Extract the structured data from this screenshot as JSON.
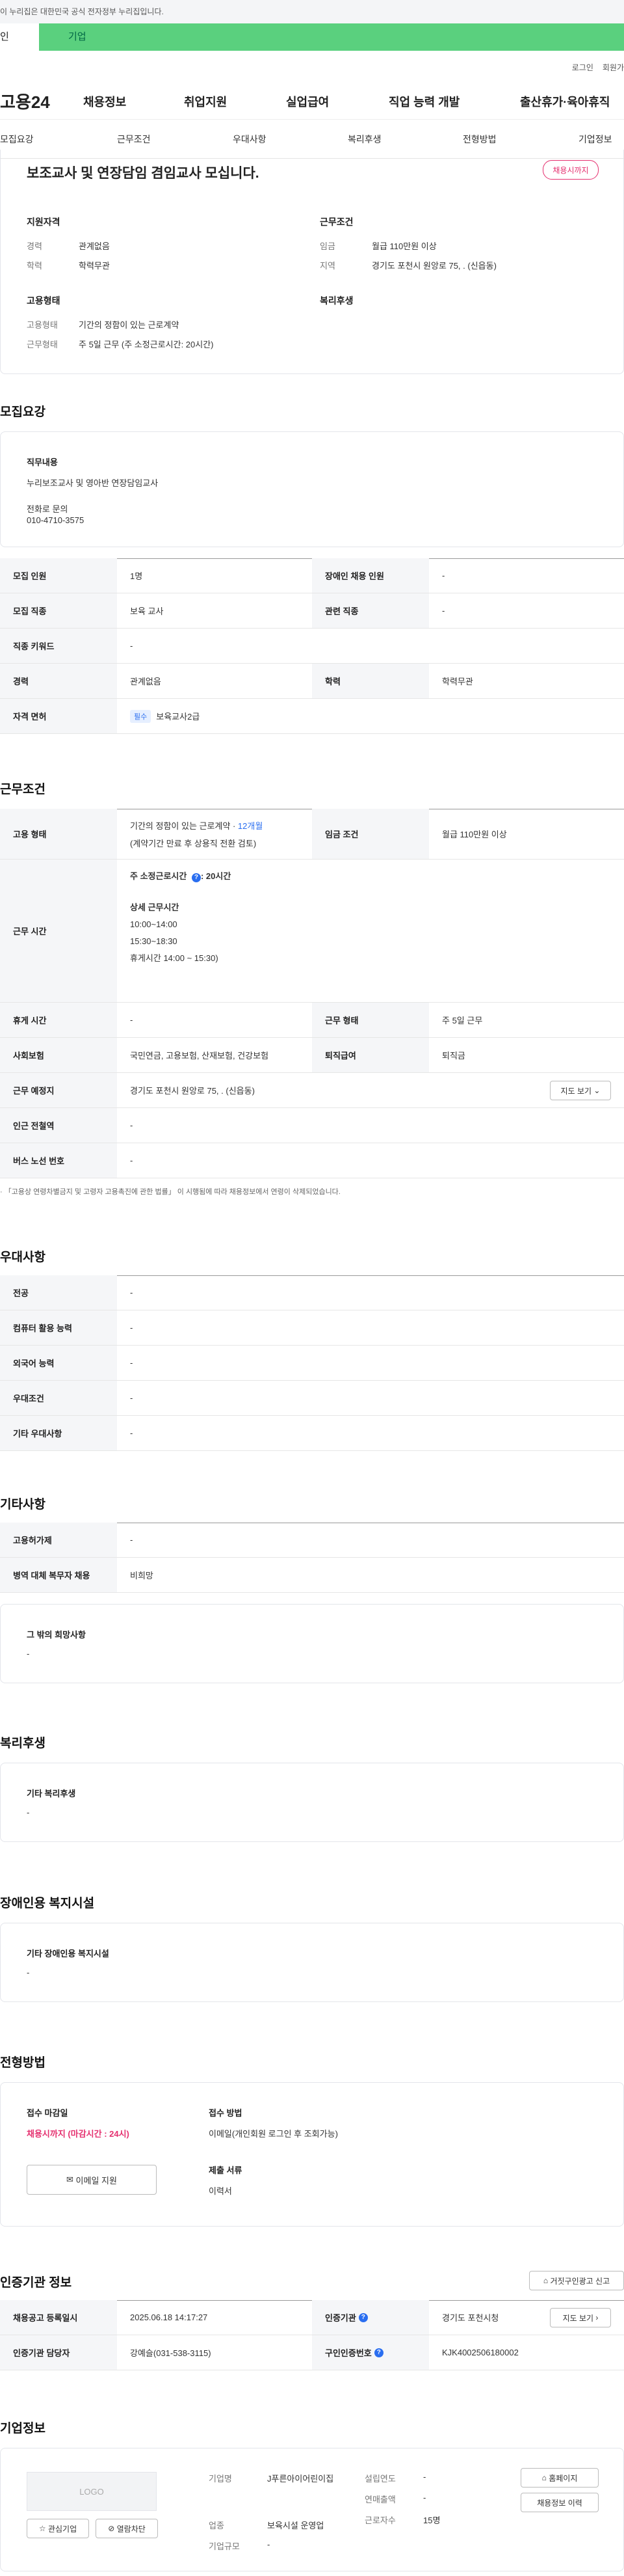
{
  "notice": "이 누리집은 대한민국 공식 전자정부 누리집입니다.",
  "tabs": {
    "person": "인",
    "biz": "기업"
  },
  "util": {
    "login": "로그인",
    "join": "회원가"
  },
  "gnb": {
    "logo": "고용24",
    "items": [
      "채용정보",
      "취업지원",
      "실업급여",
      "직업 능력 개발",
      "출산휴가·육아휴직"
    ]
  },
  "subnav": [
    "모집요강",
    "근무조건",
    "우대사항",
    "복리후생",
    "전형방법",
    "기업정보"
  ],
  "summary": {
    "title": "보조교사 및 연장담임 겸임교사 모십니다.",
    "status": "채용시까지",
    "qual_h": "지원자격",
    "career_l": "경력",
    "career_v": "관계없음",
    "edu_l": "학력",
    "edu_v": "학력무관",
    "cond_h": "근무조건",
    "wage_l": "임금",
    "wage_v": "월급 110만원 이상",
    "loc_l": "지역",
    "loc_v": "경기도 포천시 원앙로 75, . (신읍동)",
    "emp_h": "고용형태",
    "emptype_l": "고용형태",
    "emptype_v": "기간의 정함이 있는 근로계약",
    "worktype_l": "근무형태",
    "worktype_v": "주 5일 근무 (주 소정근로시간: 20시간)",
    "welfare_h": "복리후생"
  },
  "recruit": {
    "h": "모집요강",
    "job_h": "직무내용",
    "job_v": "누리보조교사 및 영아반 연장담임교사",
    "contact1": "전화로 문의",
    "contact2": "010-4710-3575",
    "rows": [
      [
        "모집 인원",
        "1명",
        "장애인 채용 인원",
        "-"
      ],
      [
        "모집 직종",
        "보육 교사",
        "관련 직종",
        "-"
      ],
      [
        "직종 키워드",
        "-"
      ],
      [
        "경력",
        "관계없음",
        "학력",
        "학력무관"
      ],
      [
        "자격 면허",
        "필수",
        "보육교사2급"
      ]
    ]
  },
  "work": {
    "h": "근무조건",
    "emp_l": "고용 형태",
    "emp_v1": "기간의 정함이 있는 근로계약 · ",
    "emp_v1b": "12개월",
    "emp_v2": "(계약기간 만료 후 상용직 전환 검토)",
    "wage_l": "임금 조건",
    "wage_v": "월급 110만원 이상",
    "time_l": "근무 시간",
    "time_main": "주 소정근로시간 ",
    "time_hours": ": 20시간",
    "detail_h": "상세 근무시간",
    "t1": "10:00~14:00",
    "t2": "15:30~18:30",
    "t3": "휴게시간 14:00 ~ 15:30)",
    "rows": [
      [
        "휴게 시간",
        "-",
        "근무 형태",
        "주 5일 근무"
      ],
      [
        "사회보험",
        "국민연금, 고용보험, 산재보험, 건강보험",
        "퇴직급여",
        "퇴직금"
      ],
      [
        "근무 예정지",
        "경기도 포천시 원앙로 75, . (신읍동)",
        "지도 보기"
      ],
      [
        "인근 전철역",
        "-"
      ],
      [
        "버스 노선 번호",
        "-"
      ]
    ],
    "footnote": "「고용상 연령차별금지 및 고령자 고용촉진에 관한 법률」 이 시행됨에 따라 채용정보에서 연령이 삭제되었습니다."
  },
  "pref": {
    "h": "우대사항",
    "rows": [
      [
        "전공",
        "-"
      ],
      [
        "컴퓨터 활용 능력",
        "-"
      ],
      [
        "외국어 능력",
        "-"
      ],
      [
        "우대조건",
        "-"
      ],
      [
        "기타 우대사항",
        "-"
      ]
    ]
  },
  "other": {
    "h": "기타사항",
    "rows": [
      [
        "고용허가제",
        "-"
      ],
      [
        "병역 대체 복무자 채용",
        "비희망"
      ]
    ],
    "box_h": "그 밖의 희망사항",
    "box_v": "-"
  },
  "welfare": {
    "h": "복리후생",
    "box_h": "기타 복리후생",
    "box_v": "-"
  },
  "disabled": {
    "h": "장애인용 복지시설",
    "box_h": "기타 장애인용 복지시설",
    "box_v": "-"
  },
  "process": {
    "h": "전형방법",
    "deadline_h": "접수 마감일",
    "deadline_v": "채용시까지 (마감시간 : 24시)",
    "method_h": "접수 방법",
    "method_v": "이메일(개인회원 로그인 후 조회가능)",
    "email_btn": "이메일 지원",
    "docs_h": "제출 서류",
    "docs_v": "이력서"
  },
  "agency": {
    "h": "인증기관 정보",
    "report_btn": "거짓구인광고 신고",
    "rows": [
      [
        "채용공고 등록일시",
        "2025.06.18 14:17:27",
        "인증기관",
        "경기도 포천시청"
      ],
      [
        "인증기관 담당자",
        "강예슬(031-538-3115)",
        "구인인증번호",
        "KJK4002506180002"
      ]
    ],
    "map_btn": "지도 보기"
  },
  "company": {
    "h": "기업정보",
    "logo": "LOGO",
    "fav_btn": "관심기업",
    "block_btn": "열람차단",
    "name_l": "기업명",
    "name_v": "J푸른아이어린이집",
    "ind_l": "업종",
    "ind_v": "보육시설 운영업",
    "size_l": "기업규모",
    "size_v": "-",
    "est_l": "설립연도",
    "est_v": "-",
    "sales_l": "연매출액",
    "sales_v": "-",
    "emp_l": "근로자수",
    "emp_v": "15명",
    "home_btn": "홈페이지",
    "hist_btn": "채용정보 이력"
  }
}
